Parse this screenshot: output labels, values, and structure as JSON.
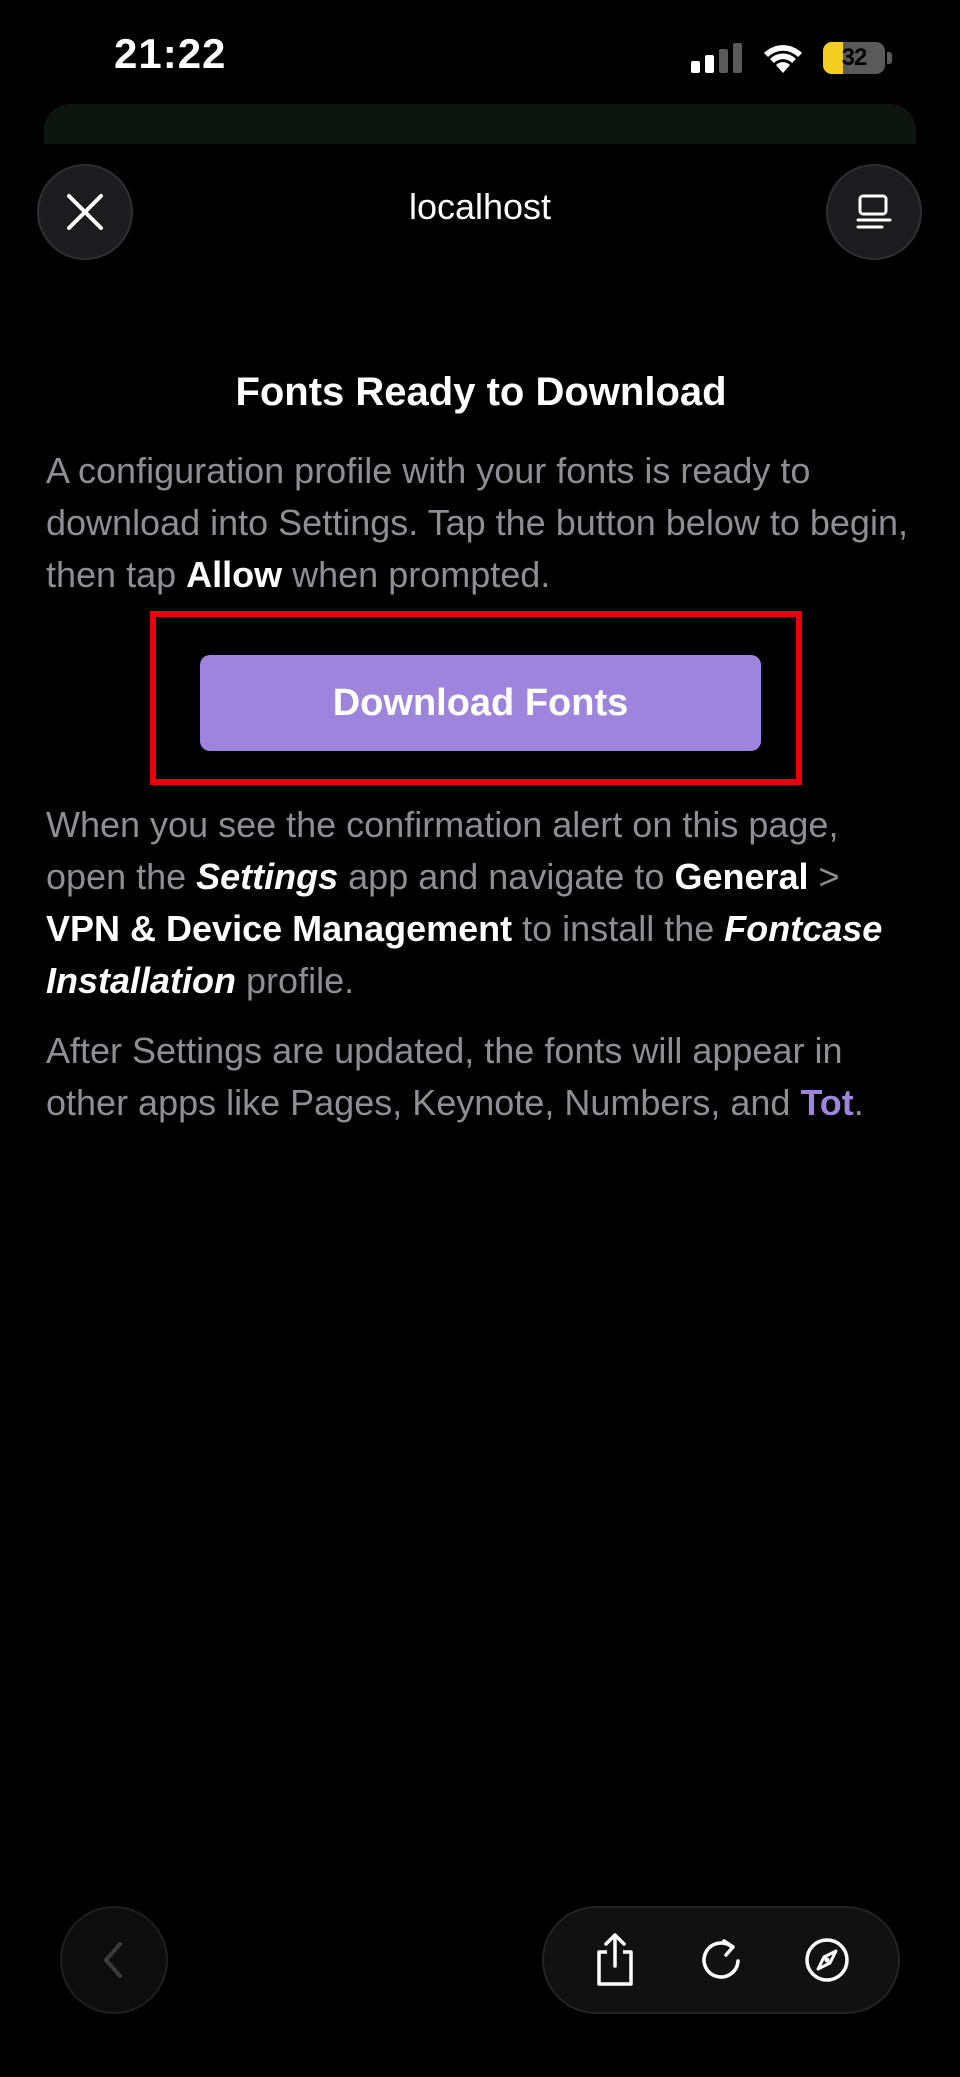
{
  "status_bar": {
    "time": "21:22",
    "battery_level": "32",
    "battery_fraction": 0.32,
    "battery_color": "#f4cf22",
    "icons": [
      "signal-icon",
      "wifi-icon",
      "battery-icon"
    ]
  },
  "header": {
    "title": "localhost",
    "close_icon": "close-icon",
    "menu_icon": "reader-menu-icon"
  },
  "content": {
    "title": "Fonts Ready to Download",
    "intro": {
      "part1": "A configuration profile with your fonts is ready to download into Settings. Tap the button below to begin, then tap ",
      "allow": "Allow",
      "part2": " when prompted."
    },
    "download_button": "Download Fonts",
    "instructions": {
      "part1": "When you see the confirmation alert on this page, open the ",
      "settings": "Settings",
      "part2": " app and navigate to ",
      "general": "General",
      "sep": " > ",
      "vpn": "VPN & Device Management",
      "part3": " to install the ",
      "profile": "Fontcase Installation",
      "part4": " profile."
    },
    "after": {
      "part1": "After Settings are updated, the fonts will appear in other apps like Pages, Keynote, Numbers, and ",
      "tot": "Tot",
      "part2": "."
    }
  },
  "colors": {
    "accent": "#9d85de",
    "highlight": "#e8000b",
    "body_text": "#8e8e93",
    "background": "#000000"
  },
  "toolbar": {
    "icons": [
      "back-chevron-icon",
      "share-icon",
      "reload-icon",
      "compass-icon"
    ]
  }
}
